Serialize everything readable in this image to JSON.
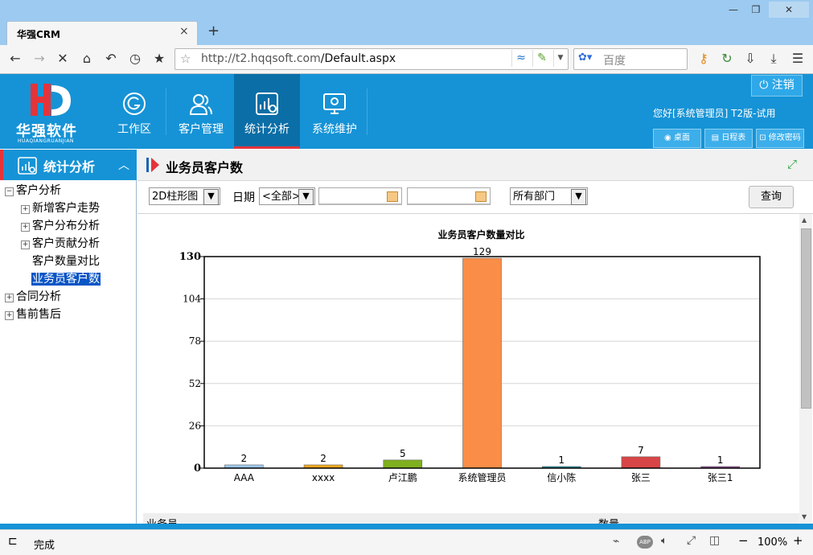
{
  "browser": {
    "tab_title": "华强CRM",
    "tab_close": "×",
    "new_tab": "+",
    "url_host": "http://t2.hqqsoft.com",
    "url_path": "/Default.aspx",
    "search_placeholder": "百度",
    "status": "完成",
    "zoom": "100%"
  },
  "header": {
    "logo_text": "华强软件",
    "logo_sub": "HUAQIANGRUANJIAN",
    "menu": [
      {
        "label": "工作区",
        "icon": "gear-circle-icon"
      },
      {
        "label": "客户管理",
        "icon": "users-icon"
      },
      {
        "label": "统计分析",
        "icon": "chart-settings-icon"
      },
      {
        "label": "系统维护",
        "icon": "monitor-settings-icon"
      }
    ],
    "logout": "注销",
    "welcome": "您好[系统管理员] T2版-试用",
    "buttons": [
      "桌面",
      "日程表",
      "修改密码"
    ]
  },
  "sidebar": {
    "title": "统计分析",
    "tree": [
      {
        "label": "客户分析",
        "level": 0,
        "toggle": "−"
      },
      {
        "label": "新增客户走势",
        "level": 1,
        "toggle": "+"
      },
      {
        "label": "客户分布分析",
        "level": 1,
        "toggle": "+"
      },
      {
        "label": "客户贡献分析",
        "level": 1,
        "toggle": "+"
      },
      {
        "label": "客户数量对比",
        "level": 1,
        "toggle": ""
      },
      {
        "label": "业务员客户数",
        "level": 1,
        "toggle": "",
        "selected": true
      },
      {
        "label": "合同分析",
        "level": 0,
        "toggle": "+"
      },
      {
        "label": "售前售后",
        "level": 0,
        "toggle": "+"
      }
    ]
  },
  "panel": {
    "title": "业务员客户数",
    "chart_type_select": "2D柱形图",
    "date_label": "日期",
    "date_select": "<全部>",
    "date_from": "",
    "date_to": "",
    "dept_select": "所有部门",
    "query_button": "查询",
    "table_header_left": "业务员",
    "table_header_right": "数量"
  },
  "chart_data": {
    "type": "bar",
    "title": "业务员客户数量对比",
    "categories": [
      "AAA",
      "xxxx",
      "卢江鹏",
      "系统管理员",
      "信小陈",
      "张三",
      "张三1"
    ],
    "values": [
      2,
      2,
      5,
      129,
      1,
      7,
      1
    ],
    "colors": [
      "#9cc8ee",
      "#f3a81d",
      "#7fb01f",
      "#fa8d47",
      "#1a8fa0",
      "#d84547",
      "#9a4d9a"
    ],
    "ylim": [
      0,
      130
    ],
    "yticks": [
      "0",
      "26",
      "52",
      "78",
      "104",
      "130"
    ],
    "grid": true
  }
}
